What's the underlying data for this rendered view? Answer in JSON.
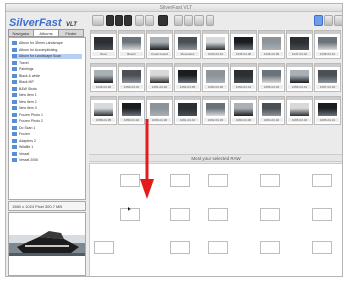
{
  "window": {
    "title": "SilverFast VLT"
  },
  "logo": {
    "brand": "SilverFast",
    "suffix": "VLT"
  },
  "tabs": [
    {
      "label": "Navigator"
    },
    {
      "label": "Albums"
    },
    {
      "label": "Finder"
    }
  ],
  "tree": [
    "Album for 35mm Landscape",
    "Album for Accomplishing",
    "Album for Landscape Scan",
    "Travel",
    "Paintings",
    "Black & white",
    "Black MP",
    "B&W Shots",
    "New Item 1",
    "New Item 2",
    "New Item 3",
    "Frozen Photo 1",
    "Frozen Photo 2",
    "Do Scan 1",
    "Frozen",
    "Adapters 2",
    "Wildlife 1",
    "Vessel",
    "Vessel 2006"
  ],
  "info": {
    "text": "1580 x 1024 Pixel 300.7 MB"
  },
  "grid": {
    "row1": [
      "Boat",
      "Beach",
      "Coast Guard",
      "Mountains",
      "1044-01.01",
      "1045-01.00",
      "1046-01.05",
      "1047-01.02",
      "1048-01.01"
    ],
    "row2": [
      "1049-01.00",
      "1050-01.01",
      "1051-01.02",
      "1052-01.05",
      "1053-01.00",
      "1054-01.01",
      "1055-01.03",
      "1056-01.01",
      "1057-01.04"
    ],
    "row3": [
      "1058-01.05",
      "1059-01.02",
      "1060-01.00",
      "1061-01.01",
      "1062-01.03",
      "1063-01.00",
      "1064-01.02",
      "1065-01.04",
      "1066-01.01"
    ]
  },
  "tray": {
    "caption": "Most your selected RAW"
  },
  "colors": {
    "accent": "#3a6ed0",
    "arrow": "#e31b1b"
  }
}
